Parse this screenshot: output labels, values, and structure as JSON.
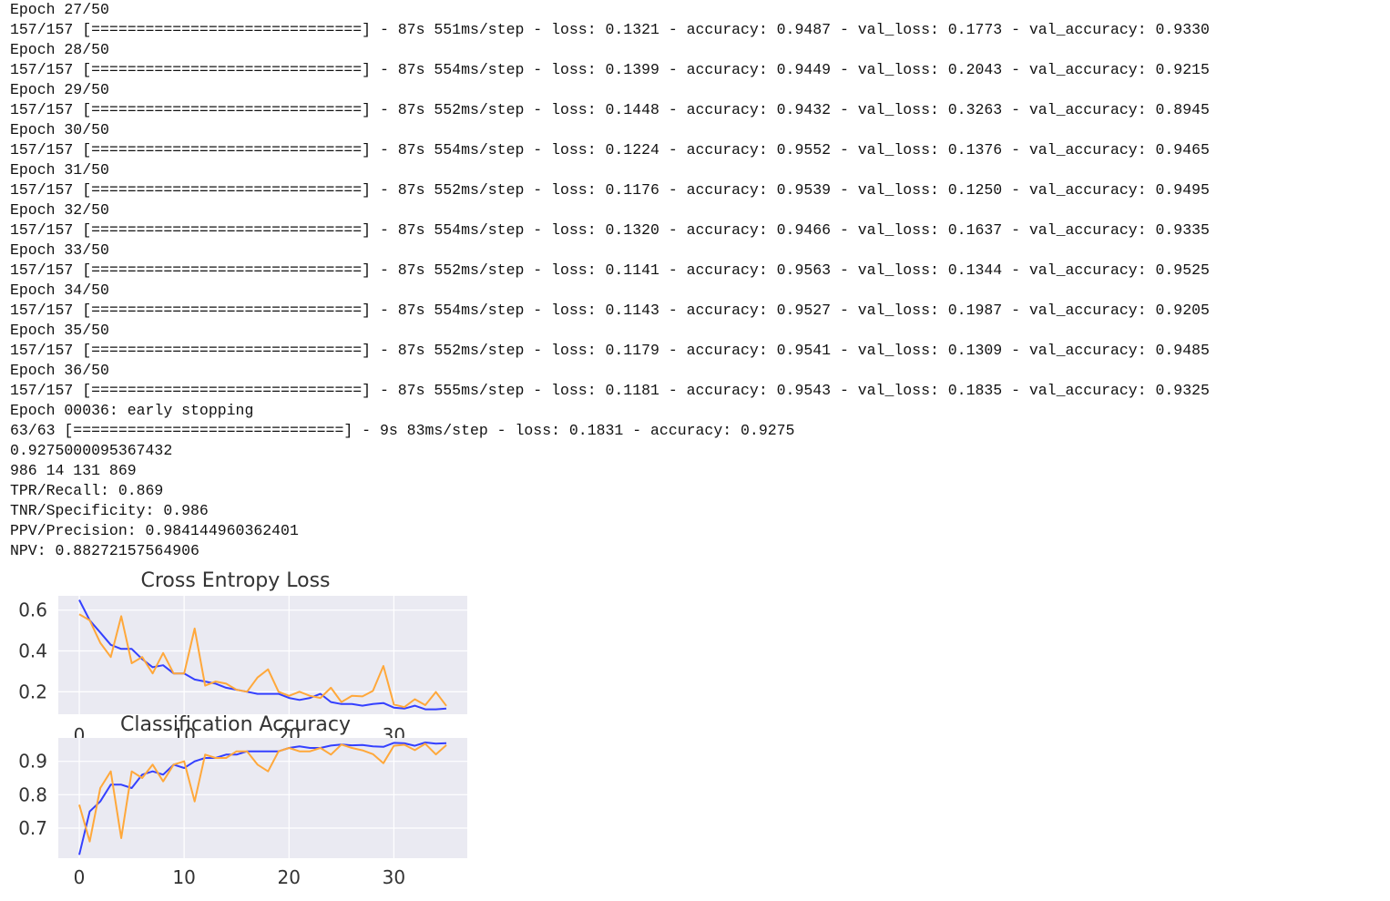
{
  "output": {
    "lines": [
      "Epoch 27/50",
      "157/157 [==============================] - 87s 551ms/step - loss: 0.1321 - accuracy: 0.9487 - val_loss: 0.1773 - val_accuracy: 0.9330",
      "Epoch 28/50",
      "157/157 [==============================] - 87s 554ms/step - loss: 0.1399 - accuracy: 0.9449 - val_loss: 0.2043 - val_accuracy: 0.9215",
      "Epoch 29/50",
      "157/157 [==============================] - 87s 552ms/step - loss: 0.1448 - accuracy: 0.9432 - val_loss: 0.3263 - val_accuracy: 0.8945",
      "Epoch 30/50",
      "157/157 [==============================] - 87s 554ms/step - loss: 0.1224 - accuracy: 0.9552 - val_loss: 0.1376 - val_accuracy: 0.9465",
      "Epoch 31/50",
      "157/157 [==============================] - 87s 552ms/step - loss: 0.1176 - accuracy: 0.9539 - val_loss: 0.1250 - val_accuracy: 0.9495",
      "Epoch 32/50",
      "157/157 [==============================] - 87s 554ms/step - loss: 0.1320 - accuracy: 0.9466 - val_loss: 0.1637 - val_accuracy: 0.9335",
      "Epoch 33/50",
      "157/157 [==============================] - 87s 552ms/step - loss: 0.1141 - accuracy: 0.9563 - val_loss: 0.1344 - val_accuracy: 0.9525",
      "Epoch 34/50",
      "157/157 [==============================] - 87s 554ms/step - loss: 0.1143 - accuracy: 0.9527 - val_loss: 0.1987 - val_accuracy: 0.9205",
      "Epoch 35/50",
      "157/157 [==============================] - 87s 552ms/step - loss: 0.1179 - accuracy: 0.9541 - val_loss: 0.1309 - val_accuracy: 0.9485",
      "Epoch 36/50",
      "157/157 [==============================] - 87s 555ms/step - loss: 0.1181 - accuracy: 0.9543 - val_loss: 0.1835 - val_accuracy: 0.9325",
      "Epoch 00036: early stopping",
      "63/63 [==============================] - 9s 83ms/step - loss: 0.1831 - accuracy: 0.9275",
      "0.9275000095367432",
      "986 14 131 869",
      "TPR/Recall: 0.869",
      "TNR/Specificity: 0.986",
      "PPV/Precision: 0.984144960362401",
      "NPV: 0.88272157564906"
    ]
  },
  "chart_data": [
    {
      "type": "line",
      "title": "Cross Entropy Loss",
      "xlim": [
        -2,
        37
      ],
      "ylim": [
        0.09,
        0.67
      ],
      "xticks": [
        0,
        10,
        20,
        30
      ],
      "xtick_labels": [
        "0",
        "10",
        "20",
        "30"
      ],
      "yticks": [
        0.2,
        0.4,
        0.6
      ],
      "ytick_labels": [
        "0.2",
        "0.4",
        "0.6"
      ],
      "grid": true,
      "x": [
        0,
        1,
        2,
        3,
        4,
        5,
        6,
        7,
        8,
        9,
        10,
        11,
        12,
        13,
        14,
        15,
        16,
        17,
        18,
        19,
        20,
        21,
        22,
        23,
        24,
        25,
        26,
        27,
        28,
        29,
        30,
        31,
        32,
        33,
        34,
        35
      ],
      "series": [
        {
          "color": "#3440ff",
          "values": [
            0.65,
            0.55,
            0.49,
            0.43,
            0.41,
            0.41,
            0.36,
            0.32,
            0.33,
            0.29,
            0.29,
            0.26,
            0.25,
            0.24,
            0.22,
            0.21,
            0.2,
            0.19,
            0.19,
            0.19,
            0.17,
            0.16,
            0.17,
            0.19,
            0.15,
            0.14,
            0.14,
            0.1321,
            0.1399,
            0.1448,
            0.1224,
            0.1176,
            0.132,
            0.1141,
            0.1143,
            0.1179
          ]
        },
        {
          "color": "#ffa83b",
          "values": [
            0.58,
            0.55,
            0.44,
            0.37,
            0.57,
            0.34,
            0.37,
            0.29,
            0.39,
            0.29,
            0.29,
            0.51,
            0.23,
            0.25,
            0.24,
            0.21,
            0.2,
            0.27,
            0.31,
            0.2,
            0.18,
            0.2,
            0.18,
            0.17,
            0.22,
            0.15,
            0.18,
            0.1773,
            0.2043,
            0.3263,
            0.1376,
            0.125,
            0.1637,
            0.1344,
            0.1987,
            0.1309
          ]
        }
      ]
    },
    {
      "type": "line",
      "title": "Classification Accuracy",
      "xlim": [
        -2,
        37
      ],
      "ylim": [
        0.61,
        0.97
      ],
      "xticks": [
        0,
        10,
        20,
        30
      ],
      "xtick_labels": [
        "0",
        "10",
        "20",
        "30"
      ],
      "yticks": [
        0.7,
        0.8,
        0.9
      ],
      "ytick_labels": [
        "0.7",
        "0.8",
        "0.9"
      ],
      "grid": true,
      "x": [
        0,
        1,
        2,
        3,
        4,
        5,
        6,
        7,
        8,
        9,
        10,
        11,
        12,
        13,
        14,
        15,
        16,
        17,
        18,
        19,
        20,
        21,
        22,
        23,
        24,
        25,
        26,
        27,
        28,
        29,
        30,
        31,
        32,
        33,
        34,
        35
      ],
      "series": [
        {
          "color": "#3440ff",
          "values": [
            0.62,
            0.75,
            0.78,
            0.83,
            0.83,
            0.82,
            0.86,
            0.87,
            0.86,
            0.89,
            0.88,
            0.9,
            0.91,
            0.91,
            0.92,
            0.92,
            0.93,
            0.93,
            0.93,
            0.93,
            0.94,
            0.945,
            0.94,
            0.94,
            0.947,
            0.95,
            0.948,
            0.9487,
            0.9449,
            0.9432,
            0.9552,
            0.9539,
            0.9466,
            0.9563,
            0.9527,
            0.9541
          ]
        },
        {
          "color": "#ffa83b",
          "values": [
            0.77,
            0.66,
            0.82,
            0.87,
            0.67,
            0.87,
            0.85,
            0.89,
            0.84,
            0.89,
            0.9,
            0.78,
            0.92,
            0.91,
            0.91,
            0.93,
            0.93,
            0.89,
            0.87,
            0.93,
            0.94,
            0.93,
            0.93,
            0.94,
            0.92,
            0.95,
            0.94,
            0.933,
            0.9215,
            0.8945,
            0.9465,
            0.9495,
            0.9335,
            0.9525,
            0.9205,
            0.9485
          ]
        }
      ]
    }
  ]
}
